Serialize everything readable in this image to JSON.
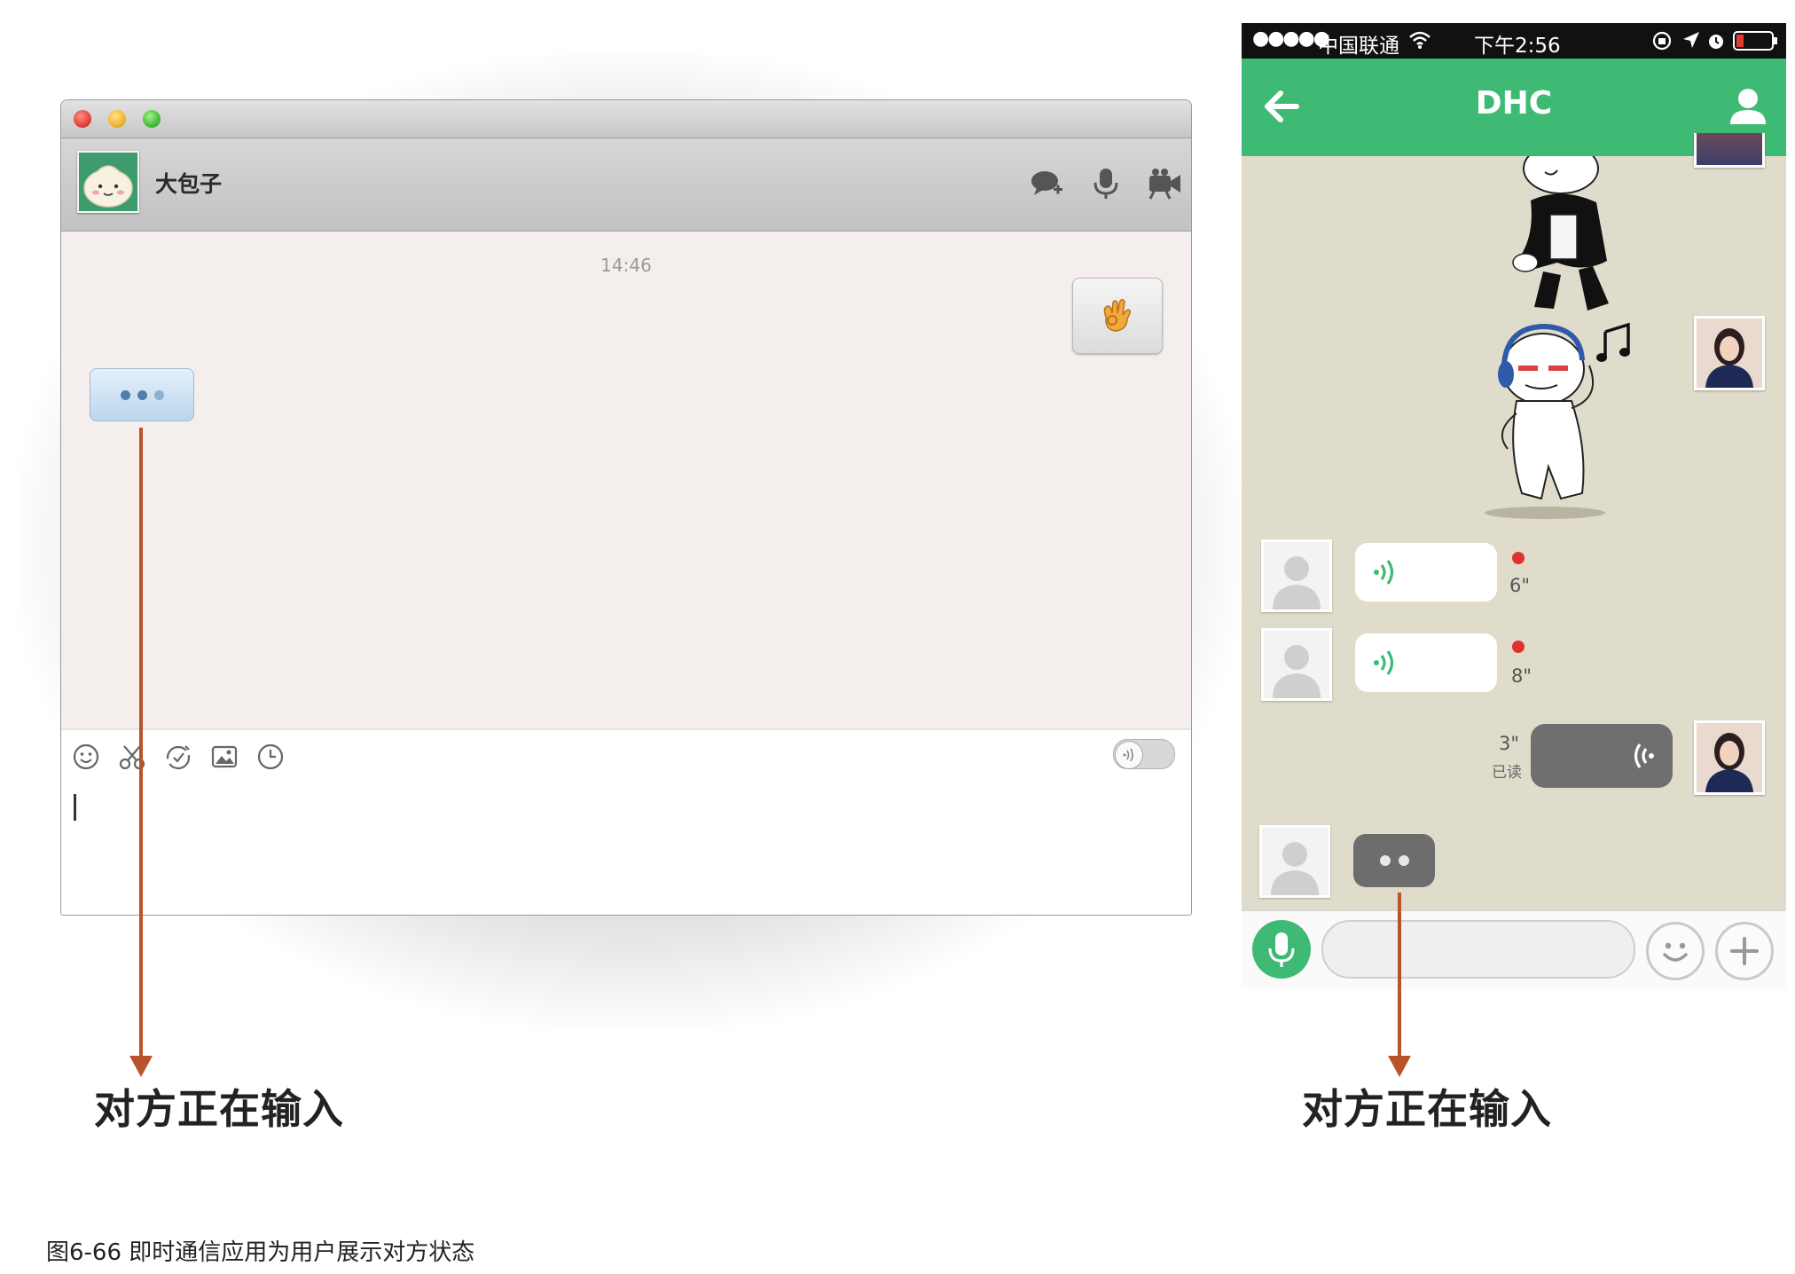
{
  "desktop": {
    "contact_name": "大包子",
    "timestamp": "14:46",
    "header_icons": [
      "chat-add-icon",
      "microphone-icon",
      "video-camera-icon",
      "file-transfer-icon"
    ],
    "toolbar_icons": [
      "emoji-icon",
      "scissors-icon",
      "screen-capture-icon",
      "image-icon",
      "clock-icon"
    ],
    "sent_message_icon": "ok-hand-icon"
  },
  "phone": {
    "status_bar": {
      "signal": "●●●●●",
      "carrier": "中国联通",
      "time": "下午2:56"
    },
    "nav_title": "DHC",
    "messages": [
      {
        "from": "contact",
        "type": "voice",
        "duration": "6\"",
        "unread": true
      },
      {
        "from": "contact",
        "type": "voice",
        "duration": "8\"",
        "unread": true
      },
      {
        "from": "me",
        "type": "voice",
        "duration": "3\"",
        "status": "已读"
      },
      {
        "from": "contact",
        "type": "typing-indicator"
      }
    ],
    "colors": {
      "accent": "#3fba74",
      "background": "#e0dccc"
    }
  },
  "annotations": {
    "desktop_label": "对方正在输入",
    "phone_label": "对方正在输入"
  },
  "caption": "图6-66 即时通信应用为用户展示对方状态"
}
